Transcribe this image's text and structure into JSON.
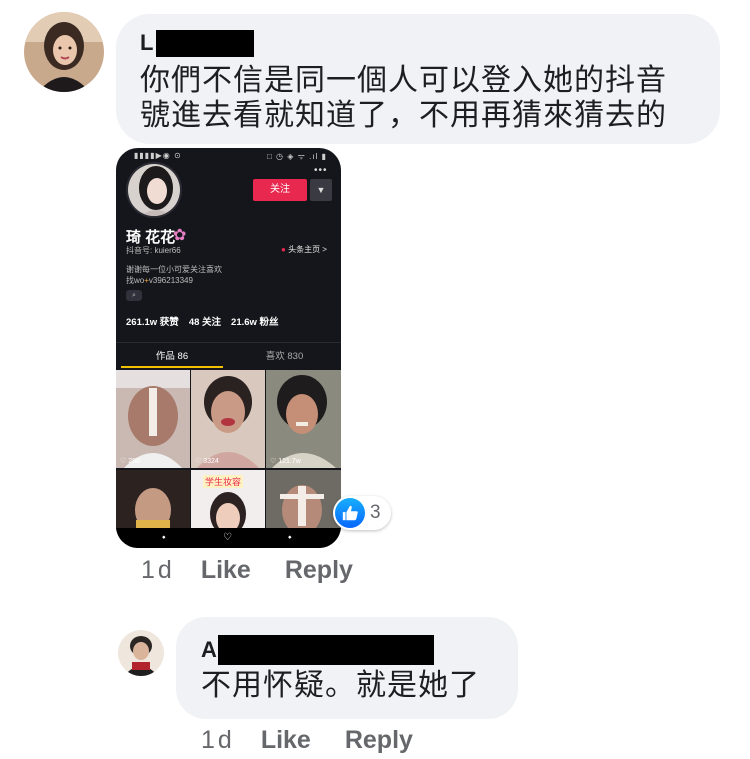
{
  "comments": [
    {
      "author_initial": "L",
      "text_lines": [
        "你們不信是同一個人可以登入她的抖音",
        "號進去看就知道了，不用再猜來猜去的"
      ],
      "time": "1d",
      "like_label": "Like",
      "reply_label": "Reply",
      "reaction_count": "3",
      "reaction_icon": "like-icon"
    },
    {
      "author_initial": "A",
      "text_lines": [
        "不用怀疑。就是她了"
      ],
      "time": "1d",
      "like_label": "Like",
      "reply_label": "Reply"
    }
  ],
  "attachment": {
    "status_left": "▮▮▮▮▶◉ ⊙",
    "status_right": "□ ◷ ◈ ᯤ .ıl ▮",
    "more": "•••",
    "follow_label": "关注",
    "dropdown": "▼",
    "name": "琦 花花",
    "flower": "✿",
    "douyin_id": "抖音号: kuier66",
    "home_label": "头条主页 >",
    "home_dot": "●",
    "bio_line1": "谢谢每一位小可爱关注喜欢",
    "bio_prefix": "找wo",
    "bio_plus": "+",
    "bio_suffix": "v396213349",
    "tag": "⌕",
    "stats": [
      "261.1w 获赞",
      "48 关注",
      "21.6w 粉丝"
    ],
    "tabs": [
      "作品 86",
      "喜欢 830"
    ],
    "thumb_likes": [
      "♡ 288",
      "♡ 3324",
      "♡ 121.7w"
    ],
    "thumb_caption": "学生妆容",
    "nav": [
      "⬩",
      "♡",
      "⬩"
    ]
  },
  "colors": {
    "bubble": "#f0f2f5",
    "meta": "#65676b",
    "follow": "#e8284f",
    "like_blue": "#0866ff"
  }
}
